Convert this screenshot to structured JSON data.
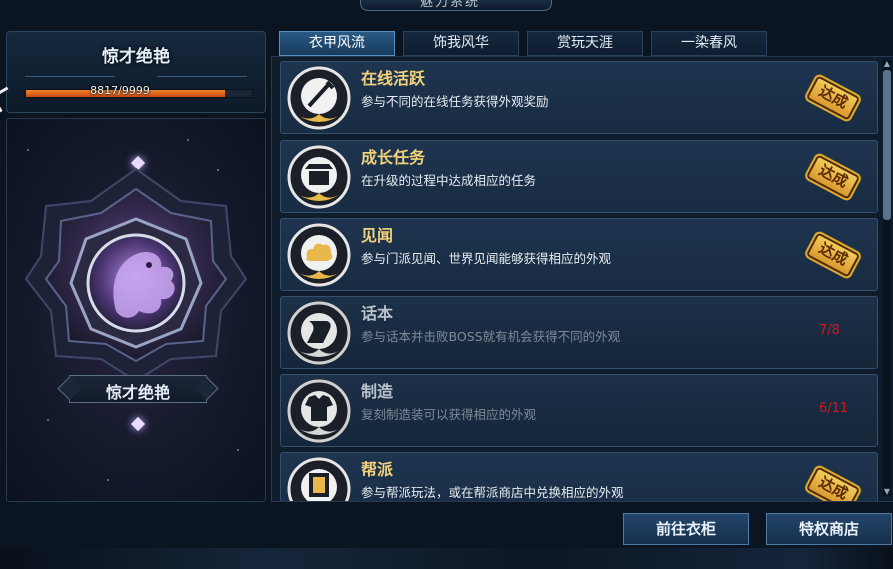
{
  "header": {
    "title": "魅力系统"
  },
  "left": {
    "title": "惊才绝艳",
    "progress_text": "8817/9999",
    "progress_value": 0.882,
    "emblem_name": "惊才绝艳"
  },
  "tabs": [
    {
      "label": "衣甲风流",
      "active": true
    },
    {
      "label": "饰我风华",
      "active": false
    },
    {
      "label": "赏玩天涯",
      "active": false
    },
    {
      "label": "一染春风",
      "active": false
    }
  ],
  "tasks": [
    {
      "title": "在线活跃",
      "desc": "参与不同的在线任务获得外观奖励",
      "status": "达成",
      "icon": "sword-icon"
    },
    {
      "title": "成长任务",
      "desc": "在升级的过程中达成相应的任务",
      "status": "达成",
      "icon": "pavilion-icon"
    },
    {
      "title": "见闻",
      "desc": "参与门派见闻、世界见闻能够获得相应的外观",
      "status": "达成",
      "icon": "cloud-scroll-icon"
    },
    {
      "title": "话本",
      "desc": "参与话本并击败BOSS就有机会获得不同的外观",
      "progress": "7/8",
      "icon": "scroll-icon"
    },
    {
      "title": "制造",
      "desc": "复刻制造装可以获得相应的外观",
      "progress": "6/11",
      "icon": "armor-icon"
    },
    {
      "title": "帮派",
      "desc": "参与帮派玩法，或在帮派商店中兑换相应的外观",
      "status": "达成",
      "icon": "banner-icon"
    }
  ],
  "buttons": {
    "wardrobe": "前往衣柜",
    "shop": "特权商店"
  },
  "colors": {
    "accent": "#f2d27a",
    "progress": "#e8702a",
    "incomplete": "#d21a1a"
  }
}
